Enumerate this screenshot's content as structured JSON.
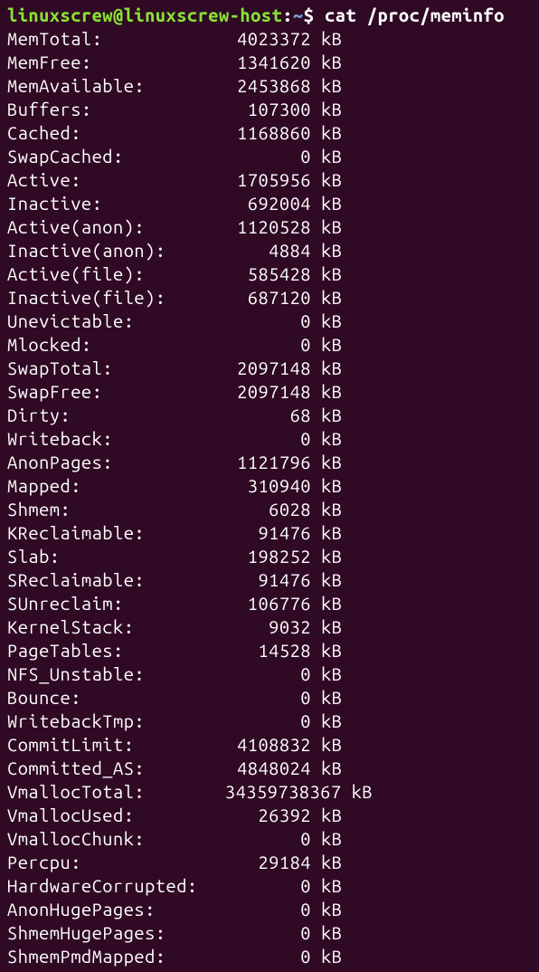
{
  "prompt": {
    "user_host": "linuxscrew@linuxscrew-host",
    "colon": ":",
    "path": "~",
    "dollar": "$",
    "command": "cat /proc/meminfo"
  },
  "rows": [
    {
      "key": "MemTotal:",
      "value": "4023372",
      "unit": "kB",
      "wide": false
    },
    {
      "key": "MemFree:",
      "value": "1341620",
      "unit": "kB",
      "wide": false
    },
    {
      "key": "MemAvailable:",
      "value": "2453868",
      "unit": "kB",
      "wide": false
    },
    {
      "key": "Buffers:",
      "value": "107300",
      "unit": "kB",
      "wide": false
    },
    {
      "key": "Cached:",
      "value": "1168860",
      "unit": "kB",
      "wide": false
    },
    {
      "key": "SwapCached:",
      "value": "0",
      "unit": "kB",
      "wide": false
    },
    {
      "key": "Active:",
      "value": "1705956",
      "unit": "kB",
      "wide": false
    },
    {
      "key": "Inactive:",
      "value": "692004",
      "unit": "kB",
      "wide": false
    },
    {
      "key": "Active(anon):",
      "value": "1120528",
      "unit": "kB",
      "wide": false
    },
    {
      "key": "Inactive(anon):",
      "value": "4884",
      "unit": "kB",
      "wide": false
    },
    {
      "key": "Active(file):",
      "value": "585428",
      "unit": "kB",
      "wide": false
    },
    {
      "key": "Inactive(file):",
      "value": "687120",
      "unit": "kB",
      "wide": false
    },
    {
      "key": "Unevictable:",
      "value": "0",
      "unit": "kB",
      "wide": false
    },
    {
      "key": "Mlocked:",
      "value": "0",
      "unit": "kB",
      "wide": false
    },
    {
      "key": "SwapTotal:",
      "value": "2097148",
      "unit": "kB",
      "wide": false
    },
    {
      "key": "SwapFree:",
      "value": "2097148",
      "unit": "kB",
      "wide": false
    },
    {
      "key": "Dirty:",
      "value": "68",
      "unit": "kB",
      "wide": false
    },
    {
      "key": "Writeback:",
      "value": "0",
      "unit": "kB",
      "wide": false
    },
    {
      "key": "AnonPages:",
      "value": "1121796",
      "unit": "kB",
      "wide": false
    },
    {
      "key": "Mapped:",
      "value": "310940",
      "unit": "kB",
      "wide": false
    },
    {
      "key": "Shmem:",
      "value": "6028",
      "unit": "kB",
      "wide": false
    },
    {
      "key": "KReclaimable:",
      "value": "91476",
      "unit": "kB",
      "wide": false
    },
    {
      "key": "Slab:",
      "value": "198252",
      "unit": "kB",
      "wide": false
    },
    {
      "key": "SReclaimable:",
      "value": "91476",
      "unit": "kB",
      "wide": false
    },
    {
      "key": "SUnreclaim:",
      "value": "106776",
      "unit": "kB",
      "wide": false
    },
    {
      "key": "KernelStack:",
      "value": "9032",
      "unit": "kB",
      "wide": false
    },
    {
      "key": "PageTables:",
      "value": "14528",
      "unit": "kB",
      "wide": false
    },
    {
      "key": "NFS_Unstable:",
      "value": "0",
      "unit": "kB",
      "wide": false
    },
    {
      "key": "Bounce:",
      "value": "0",
      "unit": "kB",
      "wide": false
    },
    {
      "key": "WritebackTmp:",
      "value": "0",
      "unit": "kB",
      "wide": false
    },
    {
      "key": "CommitLimit:",
      "value": "4108832",
      "unit": "kB",
      "wide": false
    },
    {
      "key": "Committed_AS:",
      "value": "4848024",
      "unit": "kB",
      "wide": false
    },
    {
      "key": "VmallocTotal:",
      "value": "34359738367",
      "unit": "kB",
      "wide": true
    },
    {
      "key": "VmallocUsed:",
      "value": "26392",
      "unit": "kB",
      "wide": false
    },
    {
      "key": "VmallocChunk:",
      "value": "0",
      "unit": "kB",
      "wide": false
    },
    {
      "key": "Percpu:",
      "value": "29184",
      "unit": "kB",
      "wide": false
    },
    {
      "key": "HardwareCorrupted:",
      "value": "0",
      "unit": "kB",
      "wide": false
    },
    {
      "key": "AnonHugePages:",
      "value": "0",
      "unit": "kB",
      "wide": false
    },
    {
      "key": "ShmemHugePages:",
      "value": "0",
      "unit": "kB",
      "wide": false
    },
    {
      "key": "ShmemPmdMapped:",
      "value": "0",
      "unit": "kB",
      "wide": false
    }
  ]
}
